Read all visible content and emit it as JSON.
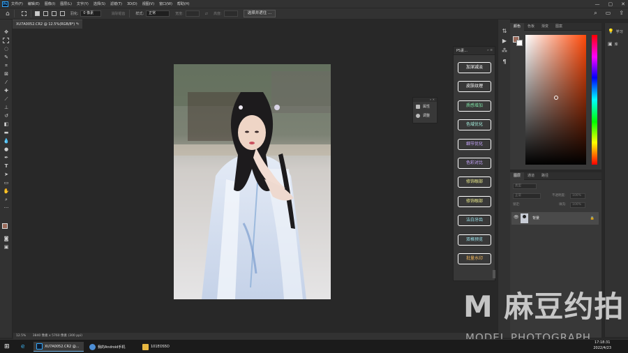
{
  "app": {
    "logo": "Ps",
    "window_controls": [
      "—",
      "▢",
      "✕"
    ]
  },
  "menu": [
    "文件(F)",
    "编辑(E)",
    "图像(I)",
    "图层(L)",
    "文字(Y)",
    "选择(S)",
    "滤镜(T)",
    "3D(D)",
    "视图(V)",
    "窗口(W)",
    "帮助(H)"
  ],
  "options": {
    "feather_label": "羽化:",
    "feather_value": "0 像素",
    "antialias_label": "消除锯齿",
    "style_label": "样式:",
    "style_value": "正常",
    "width_label": "宽度:",
    "height_label": "高度:",
    "select_mask_button": "选择并遮住 ..."
  },
  "document": {
    "tab_title": "XU7A0052.CR2 @ 12.5%(RGB/8*) *",
    "close": "×"
  },
  "status": {
    "zoom": "12.5%",
    "info": "3840 像素 x 5760 像素 (300 ppi)"
  },
  "plugin_panel": {
    "title": "PS素...",
    "header_ctrl": "»  ≡",
    "buttons": [
      {
        "label": "加深减淡",
        "color": "#ffffff"
      },
      {
        "label": "皮肤纹理",
        "color": "#ffffff"
      },
      {
        "label": "质感增加",
        "color": "#7fe3a6"
      },
      {
        "label": "色域优化",
        "color": "#a7f2e0"
      },
      {
        "label": "细节优化",
        "color": "#c8a6ff"
      },
      {
        "label": "色彩对比",
        "color": "#c8a6ff"
      },
      {
        "label": "修饰眼部",
        "color": "#e9e98a"
      },
      {
        "label": "修饰眼部",
        "color": "#e9e98a"
      },
      {
        "label": "洁白牙齿",
        "color": "#9ee8f2"
      },
      {
        "label": "双格预览",
        "color": "#9ee8f2"
      },
      {
        "label": "批量水印",
        "color": "#f2b75a"
      }
    ]
  },
  "mini_panel": {
    "header": "»  ✕",
    "items": [
      "属性",
      "调整"
    ]
  },
  "color_panel": {
    "tabs": [
      "颜色",
      "色板",
      "渐变",
      "图案"
    ],
    "foreground": "#9a6a5a",
    "background": "#ffffff"
  },
  "layers_panel": {
    "tabs": [
      "图层",
      "通道",
      "路径"
    ],
    "kind_label": "类型",
    "mode_label": "正常",
    "opacity_label": "不透明度:",
    "opacity_value": "100%",
    "lock_label": "锁定:",
    "fill_label": "填充:",
    "fill_value": "100%",
    "layer_name": "背景",
    "eye": "👁",
    "lock": "🔒"
  },
  "learn_panel": {
    "items": [
      "学习",
      "库"
    ]
  },
  "taskbar": {
    "items": [
      "XU7A0052.CR2 @...",
      "我的Android手机",
      "101EOS5D"
    ],
    "time": "17:18:31",
    "date": "2022/4/23",
    "colors": [
      "#31a8ff",
      "#4d8fd6",
      "#e7b741"
    ]
  },
  "watermark": {
    "main": "M 麻豆约拍",
    "sub": "MODEL PHOTOGRAPH"
  }
}
